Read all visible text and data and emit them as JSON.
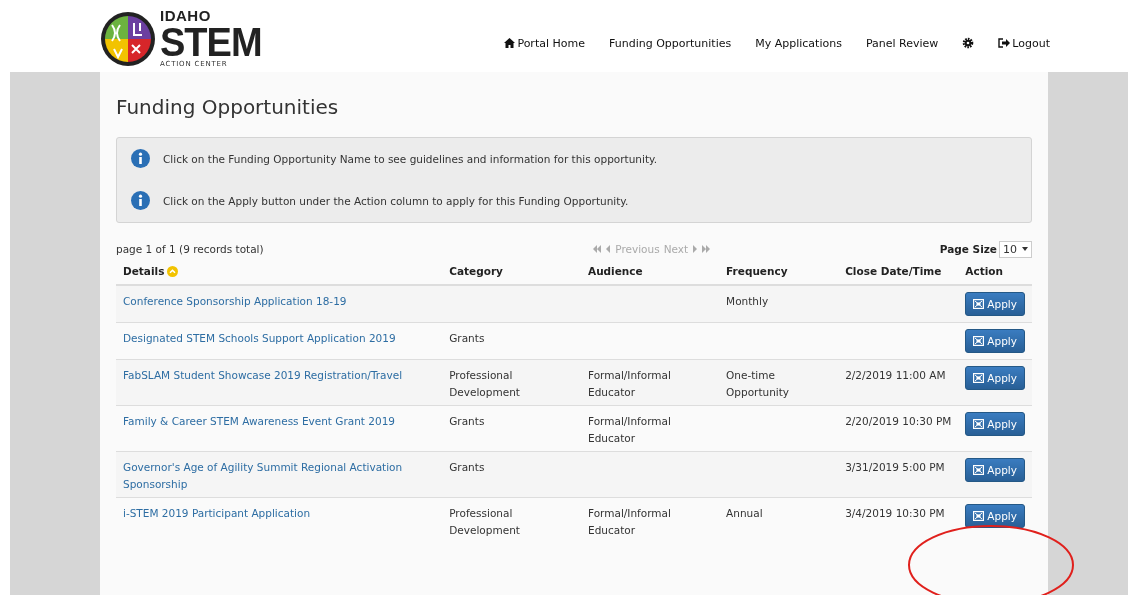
{
  "logo": {
    "line_1": "IDAHO",
    "line_2": "STEM",
    "line_3": "ACTION CENTER"
  },
  "nav": [
    {
      "label": "Portal Home",
      "kind": "home"
    },
    {
      "label": "Funding Opportunities",
      "kind": "text"
    },
    {
      "label": "My Applications",
      "kind": "text"
    },
    {
      "label": "Panel Review",
      "kind": "text"
    },
    {
      "kind": "settings"
    },
    {
      "label": "Logout",
      "kind": "logout"
    }
  ],
  "page_title": "Funding Opportunities",
  "info_notes": [
    "Click on the Funding Opportunity Name to see guidelines and information for this opportunity.",
    "Click on the Apply button under the Action column to apply for this Funding Opportunity."
  ],
  "pager": {
    "summary": "page 1 of 1 (9 records total)",
    "previous": "Previous",
    "next": "Next",
    "disabled": true,
    "page_size_label": "Page Size",
    "page_size": "10"
  },
  "table": {
    "columns": [
      "Details",
      "Category",
      "Audience",
      "Frequency",
      "Close Date/Time",
      "Action"
    ],
    "rows": [
      {
        "details": "Conference Sponsorship Application 18-19",
        "category": "",
        "audience": "",
        "frequency": "Monthly",
        "close": "",
        "action": "Apply"
      },
      {
        "details": "Designated STEM Schools Support Application 2019",
        "category": "Grants",
        "audience": "",
        "frequency": "",
        "close": "",
        "action": "Apply"
      },
      {
        "details": "FabSLAM Student Showcase 2019 Registration/Travel",
        "category": "Professional Development",
        "audience": "Formal/Informal Educator",
        "frequency": "One-time Opportunity",
        "close": "2/2/2019 11:00 AM",
        "action": "Apply"
      },
      {
        "details": "Family & Career STEM Awareness Event Grant 2019",
        "category": "Grants",
        "audience": "Formal/Informal Educator",
        "frequency": "",
        "close": "2/20/2019 10:30 PM",
        "action": "Apply"
      },
      {
        "details": "Governor's Age of Agility Summit Regional Activation Sponsorship",
        "category": "Grants",
        "audience": "",
        "frequency": "",
        "close": "3/31/2019 5:00 PM",
        "action": "Apply"
      },
      {
        "details": "i-STEM 2019 Participant Application",
        "category": "Professional Development",
        "audience": "Formal/Informal Educator",
        "frequency": "Annual",
        "close": "3/4/2019 10:30 PM",
        "action": "Apply"
      }
    ]
  }
}
